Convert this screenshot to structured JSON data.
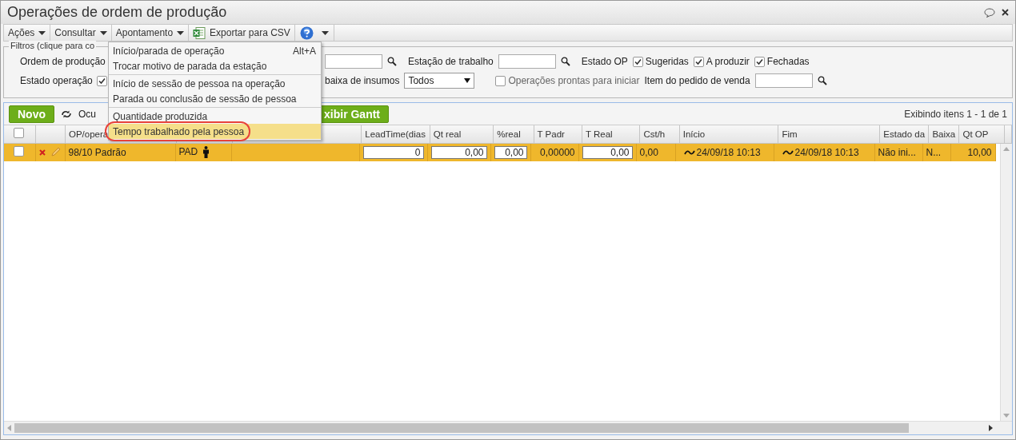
{
  "window": {
    "title": "Operações de ordem de produção"
  },
  "menubar": [
    {
      "kind": "dropdown",
      "label": "Ações"
    },
    {
      "kind": "dropdown",
      "label": "Consultar"
    },
    {
      "kind": "dropdown",
      "label": "Apontamento"
    },
    {
      "kind": "csv",
      "label": "Exportar para CSV"
    },
    {
      "kind": "help"
    }
  ],
  "open_menu": {
    "groups": [
      [
        {
          "label": "Início/parada de operação",
          "shortcut": "Alt+A",
          "selected": false,
          "circled": false
        },
        {
          "label": "Trocar motivo de parada da estação",
          "selected": false,
          "circled": false
        }
      ],
      [
        {
          "label": "Início de sessão de pessoa na operação",
          "selected": false,
          "circled": false
        },
        {
          "label": "Parada ou conclusão de sessão de pessoa",
          "selected": false,
          "circled": false
        }
      ],
      [
        {
          "label": "Quantidade produzida",
          "selected": false,
          "circled": false
        },
        {
          "label": "Tempo trabalhado pela pessoa",
          "selected": true,
          "circled": true
        }
      ]
    ]
  },
  "filters": {
    "legend": "Filtros (clique para co",
    "rows": [
      {
        "left": [
          {
            "kind": "label",
            "text": "Ordem de produção"
          }
        ],
        "right": [
          {
            "kind": "input"
          },
          {
            "kind": "search"
          },
          {
            "kind": "label",
            "text": "Estação de trabalho"
          },
          {
            "kind": "input"
          },
          {
            "kind": "search"
          },
          {
            "kind": "label",
            "text": "Estado OP"
          },
          {
            "kind": "checkbox",
            "text": "Sugeridas",
            "checked": true
          },
          {
            "kind": "checkbox",
            "text": "A produzir",
            "checked": true
          },
          {
            "kind": "checkbox",
            "text": "Fechadas",
            "checked": true
          }
        ]
      },
      {
        "left": [
          {
            "kind": "label",
            "text": "Estado operação"
          },
          {
            "kind": "checkbox",
            "checked": true
          }
        ],
        "right": [
          {
            "kind": "label",
            "text": "baixa de insumos"
          },
          {
            "kind": "select",
            "value": "Todos"
          },
          {
            "kind": "checkbox",
            "text": "Operações prontas para iniciar",
            "checked": false
          },
          {
            "kind": "label",
            "text": "Item do pedido de venda"
          },
          {
            "kind": "input"
          },
          {
            "kind": "search"
          }
        ]
      }
    ]
  },
  "toolbar": {
    "new_button": "Novo",
    "hide_label": "Ocu",
    "gantt_button": "xibir Gantt",
    "paging": "Exibindo itens 1 - 1 de 1"
  },
  "table": {
    "select_all_checked": false,
    "columns": [
      {
        "kind": "checkbox"
      },
      {
        "kind": "blank"
      },
      {
        "kind": "text",
        "label": "OP/opera"
      },
      {
        "kind": "blank"
      },
      {
        "kind": "blank"
      },
      {
        "kind": "text",
        "label": "LeadTime(dias"
      },
      {
        "kind": "text",
        "label": "Qt real"
      },
      {
        "kind": "text",
        "label": "%real"
      },
      {
        "kind": "text",
        "label": "T Padr"
      },
      {
        "kind": "text",
        "label": "T Real"
      },
      {
        "kind": "text",
        "label": "Cst/h"
      },
      {
        "kind": "text",
        "label": "Início"
      },
      {
        "kind": "text",
        "label": "Fim"
      },
      {
        "kind": "text",
        "label": "Estado da"
      },
      {
        "kind": "text",
        "label": "Baixa"
      },
      {
        "kind": "text",
        "label": "Qt OP"
      }
    ],
    "rows": [
      {
        "checked": false,
        "cells": [
          {
            "kind": "checkbox"
          },
          {
            "kind": "actions"
          },
          {
            "kind": "text",
            "value": "98/10 Padrão"
          },
          {
            "kind": "person",
            "value": "PAD"
          },
          {
            "kind": "blank"
          },
          {
            "kind": "input",
            "value": "0"
          },
          {
            "kind": "input",
            "value": "0,00"
          },
          {
            "kind": "input",
            "value": "0,00"
          },
          {
            "kind": "number",
            "value": "0,00000"
          },
          {
            "kind": "input",
            "value": "0,00"
          },
          {
            "kind": "text",
            "value": "0,00"
          },
          {
            "kind": "tilde",
            "value": "24/09/18 10:13"
          },
          {
            "kind": "tilde",
            "value": "24/09/18 10:13"
          },
          {
            "kind": "text",
            "value": "Não ini..."
          },
          {
            "kind": "text",
            "value": "N..."
          },
          {
            "kind": "number",
            "value": "10,00"
          }
        ]
      }
    ]
  }
}
